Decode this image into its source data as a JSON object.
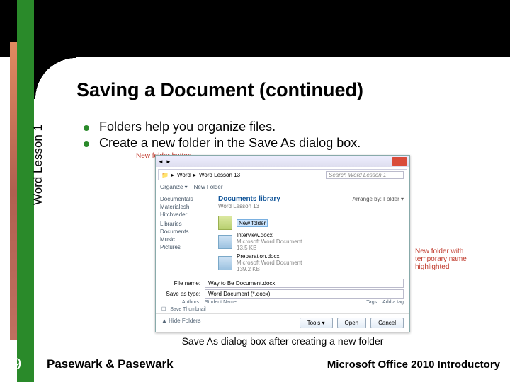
{
  "slide": {
    "title": "Saving a Document (continued)",
    "bullets": [
      "Folders help you organize files.",
      "Create a new folder in the Save As dialog box."
    ],
    "sidebar_label": "Word  Lesson 1",
    "caption": "Save As dialog box after creating a new folder",
    "page_number": "9",
    "footer_left": "Pasewark & Pasewark",
    "footer_right": "Microsoft Office 2010 Introductory"
  },
  "annotations": {
    "new_folder_button": "New folder button",
    "new_folder_highlight_l1": "New folder with",
    "new_folder_highlight_l2": "temporary name",
    "new_folder_highlight_l3": "highlighted"
  },
  "dialog": {
    "breadcrumb_parts": [
      "Word",
      "Word Lesson 13"
    ],
    "search_placeholder": "Search Word Lesson 1",
    "toolbar_organize": "Organize ▾",
    "toolbar_newfolder": "New Folder",
    "library_header": "Documents library",
    "library_sub": "Word Lesson 13",
    "arrange_by": "Arrange by:  Folder ▾",
    "side_items": [
      "Documentals",
      "Materialesh",
      "Hitchvader",
      "",
      "Libraries",
      "Documents",
      "Music",
      "Pictures"
    ],
    "items": [
      {
        "name": "New folder",
        "highlighted": true
      },
      {
        "name": "Interview.docx",
        "meta1": "Microsoft Word Document",
        "meta2": "13.5 KB"
      },
      {
        "name": "Preparation.docx",
        "meta1": "Microsoft Word Document",
        "meta2": "139.2 KB"
      }
    ],
    "filename_label": "File name:",
    "filename_value": "Way to Be Document.docx",
    "savetype_label": "Save as type:",
    "savetype_value": "Word Document (*.docx)",
    "authors_label": "Authors:",
    "authors_value": "Student Name",
    "tags_label": "Tags:",
    "tags_value": "Add a tag",
    "hide_folders": "Hide Folders",
    "tools": "Tools ▾",
    "open": "Open",
    "cancel": "Cancel",
    "save_thumbnail": "Save Thumbnail"
  }
}
